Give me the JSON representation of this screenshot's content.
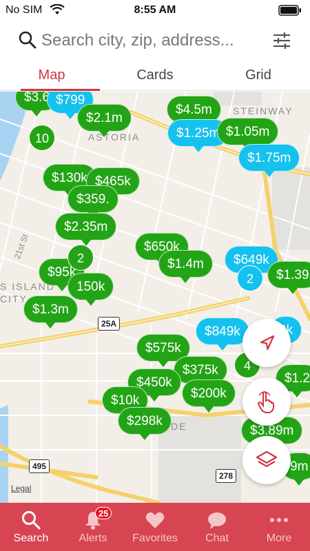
{
  "status_bar": {
    "carrier": "No SIM",
    "time": "8:55 AM"
  },
  "search": {
    "placeholder": "Search city, zip, address..."
  },
  "tabs": [
    {
      "label": "Map",
      "active": true
    },
    {
      "label": "Cards",
      "active": false
    },
    {
      "label": "Grid",
      "active": false
    }
  ],
  "map": {
    "labels": {
      "astoria": "ASTORIA",
      "steinway": "STEINWAY",
      "st21": "21st St",
      "island": "S ISLAND",
      "city": "CITY",
      "de": "DE",
      "legal": "Legal"
    },
    "shields": {
      "r25a": "25A",
      "r495": "495",
      "r278": "278"
    },
    "pins": [
      {
        "label": "$3.6",
        "color": "green"
      },
      {
        "label": "$799",
        "color": "blue"
      },
      {
        "label": "$2.1m",
        "color": "green"
      },
      {
        "label": "$4.5m",
        "color": "green"
      },
      {
        "label": "$1.25m",
        "color": "blue"
      },
      {
        "label": "$1.05m",
        "color": "green"
      },
      {
        "label": "$1.75m",
        "color": "blue"
      },
      {
        "label": "$130k",
        "color": "green"
      },
      {
        "label": "$465k",
        "color": "green"
      },
      {
        "label": "$359.",
        "color": "green"
      },
      {
        "label": "$2.35m",
        "color": "green"
      },
      {
        "label": "$650k",
        "color": "green"
      },
      {
        "label": "$1.4m",
        "color": "green"
      },
      {
        "label": "$649k",
        "color": "blue"
      },
      {
        "label": "$1.39",
        "color": "green"
      },
      {
        "label": "$95k",
        "color": "green"
      },
      {
        "label": "150k",
        "color": "green"
      },
      {
        "label": "$1.3m",
        "color": "green"
      },
      {
        "label": "$849k",
        "color": "blue"
      },
      {
        "label": "9k",
        "color": "blue"
      },
      {
        "label": "$575k",
        "color": "green"
      },
      {
        "label": "$375k",
        "color": "green"
      },
      {
        "label": "$450k",
        "color": "green"
      },
      {
        "label": "$200k",
        "color": "green"
      },
      {
        "label": "$10k",
        "color": "green"
      },
      {
        "label": "$298k",
        "color": "green"
      },
      {
        "label": "$1.2",
        "color": "green"
      },
      {
        "label": "$3.89m",
        "color": "green"
      },
      {
        "label": "9m",
        "color": "green"
      }
    ],
    "clusters": [
      {
        "label": "10",
        "color": "green"
      },
      {
        "label": "2",
        "color": "green"
      },
      {
        "label": "2",
        "color": "blue"
      },
      {
        "label": "4",
        "color": "green"
      }
    ]
  },
  "colors": {
    "accent": "#d0343f",
    "tab_bar": "#d74552",
    "pin_green": "#23a416",
    "pin_blue": "#15c1ee"
  },
  "bottom_tabs": [
    {
      "label": "Search",
      "icon": "search-icon",
      "active": true
    },
    {
      "label": "Alerts",
      "icon": "bell-icon",
      "badge": "25"
    },
    {
      "label": "Favorites",
      "icon": "heart-icon"
    },
    {
      "label": "Chat",
      "icon": "chat-icon"
    },
    {
      "label": "More",
      "icon": "more-icon"
    }
  ]
}
